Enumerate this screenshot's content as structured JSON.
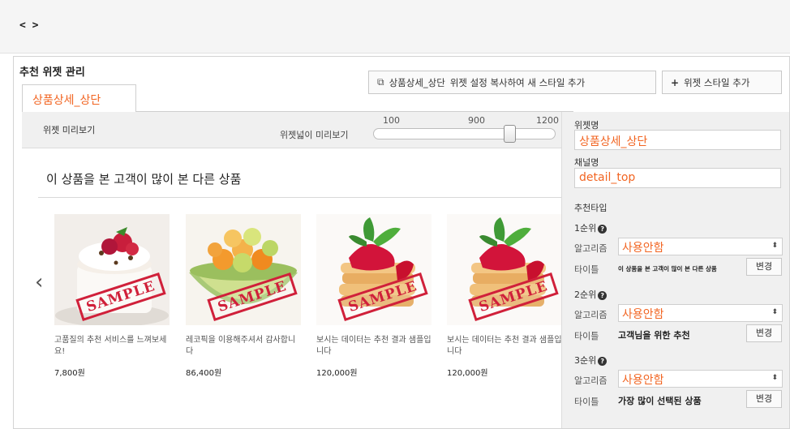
{
  "topbar": {
    "code": "< >"
  },
  "header": {
    "title": "추천 위젯 관리",
    "copy_button": {
      "target": "상품상세_상단",
      "label": "위젯 설정 복사하여 새 스타일 추가"
    },
    "add_button": "위젯 스타일 추가"
  },
  "tabs": [
    {
      "label": "상품상세_상단",
      "active": true
    }
  ],
  "preview": {
    "label": "위젯 미리보기",
    "width_label": "위젯넓이 미리보기",
    "slider": {
      "min_label": "100",
      "mid_label": "900",
      "max_label": "1200",
      "min": 100,
      "max": 1200,
      "value": 1100
    },
    "section_title": "이 상품을 본 고객이 많이 본 다른 상품",
    "stamp_text": "SAMPLE",
    "products": [
      {
        "name": "고품질의 추천 서비스를 느껴보세요!",
        "price": "7,800원",
        "image": "strawberry-yogurt"
      },
      {
        "name": "레코픽을 이용해주셔서 감사합니다",
        "price": "86,400원",
        "image": "melon-balls"
      },
      {
        "name": "보시는 데이터는 추천 결과 샘플입니다",
        "price": "120,000원",
        "image": "strawberry-pancakes"
      },
      {
        "name": "보시는 데이터는 추천 결과 샘플입니다",
        "price": "120,000원",
        "image": "strawberry-pancakes"
      }
    ]
  },
  "settings": {
    "widget_name_label": "위젯명",
    "widget_name": "상품상세_상단",
    "channel_label": "채널명",
    "channel": "detail_top",
    "rec_type_label": "추천타입",
    "algo_label": "알고리즘",
    "title_label": "타이틀",
    "change_label": "변경",
    "ranks": [
      {
        "label": "1순위",
        "algorithm": "사용안함",
        "title": "이 상품을 본 고객이 많이 본 다른 상품"
      },
      {
        "label": "2순위",
        "algorithm": "사용안함",
        "title": "고객님을 위한 추천"
      },
      {
        "label": "3순위",
        "algorithm": "사용안함",
        "title": "가장 많이 선택된 상품"
      }
    ]
  },
  "colors": {
    "accent": "#f26522",
    "stamp": "#d0203a"
  },
  "icons": {
    "copy": "copy-icon",
    "add": "plus-icon",
    "prev": "chevron-left-icon",
    "help": "question-icon"
  }
}
